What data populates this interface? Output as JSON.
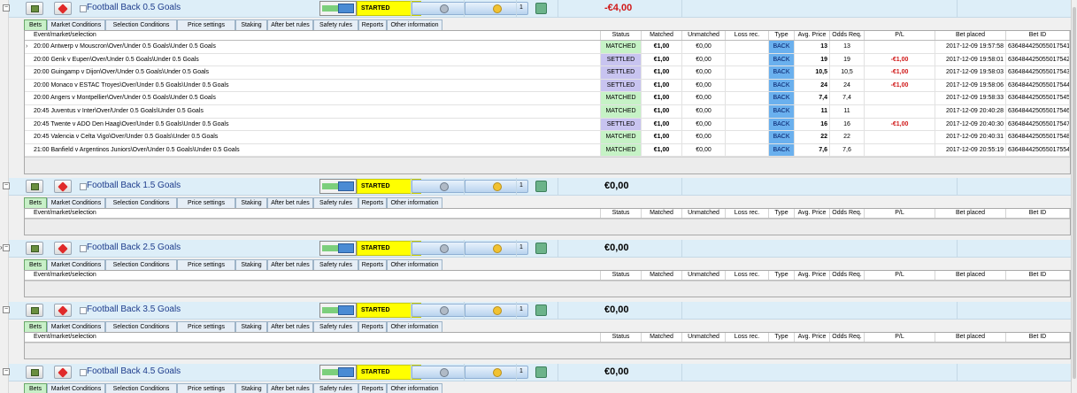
{
  "tab_labels": [
    "Bets",
    "Market Conditions",
    "Selection Conditions",
    "Price settings",
    "Staking",
    "After bet rules",
    "Safety rules",
    "Reports",
    "Other information"
  ],
  "columns": {
    "event": "Event/market/selection",
    "status": "Status",
    "matched": "Matched",
    "unmatched": "Unmatched",
    "loss_rec": "Loss rec.",
    "type": "Type",
    "avg_price": "Avg. Price",
    "odds_req": "Odds Req.",
    "pl": "P/L",
    "bet_placed": "Bet placed",
    "bet_id": "Bet ID"
  },
  "strategies": [
    {
      "name": "Football Back 0.5 Goals",
      "state": "STARTED",
      "count": "1",
      "profit_loss": "-€4,00",
      "bets": [
        {
          "event": "20:00 Antwerp v Mouscron\\Over/Under 0.5 Goals\\Under 0.5 Goals",
          "status": "MATCHED",
          "matched": "€1,00",
          "unmatched": "€0,00",
          "loss_rec": "",
          "type": "BACK",
          "avg_price": "13",
          "odds_req": "13",
          "pl": "",
          "bet_placed": "2017-12-09 19:57:58",
          "bet_id": "636484425055017541"
        },
        {
          "event": "20:00 Genk v Eupen\\Over/Under 0.5 Goals\\Under 0.5 Goals",
          "status": "SETTLED",
          "matched": "€1,00",
          "unmatched": "€0,00",
          "loss_rec": "",
          "type": "BACK",
          "avg_price": "19",
          "odds_req": "19",
          "pl": "-€1,00",
          "bet_placed": "2017-12-09 19:58:01",
          "bet_id": "636484425055017542"
        },
        {
          "event": "20:00 Guingamp v Dijon\\Over/Under 0.5 Goals\\Under 0.5 Goals",
          "status": "SETTLED",
          "matched": "€1,00",
          "unmatched": "€0,00",
          "loss_rec": "",
          "type": "BACK",
          "avg_price": "10,5",
          "odds_req": "10,5",
          "pl": "-€1,00",
          "bet_placed": "2017-12-09 19:58:03",
          "bet_id": "636484425055017543"
        },
        {
          "event": "20:00 Monaco v ESTAC Troyes\\Over/Under 0.5 Goals\\Under 0.5 Goals",
          "status": "SETTLED",
          "matched": "€1,00",
          "unmatched": "€0,00",
          "loss_rec": "",
          "type": "BACK",
          "avg_price": "24",
          "odds_req": "24",
          "pl": "-€1,00",
          "bet_placed": "2017-12-09 19:58:06",
          "bet_id": "636484425055017544"
        },
        {
          "event": "20:00 Angers v Montpellier\\Over/Under 0.5 Goals\\Under 0.5 Goals",
          "status": "MATCHED",
          "matched": "€1,00",
          "unmatched": "€0,00",
          "loss_rec": "",
          "type": "BACK",
          "avg_price": "7,4",
          "odds_req": "7,4",
          "pl": "",
          "bet_placed": "2017-12-09 19:58:33",
          "bet_id": "636484425055017545"
        },
        {
          "event": "20:45 Juventus v Inter\\Over/Under 0.5 Goals\\Under 0.5 Goals",
          "status": "MATCHED",
          "matched": "€1,00",
          "unmatched": "€0,00",
          "loss_rec": "",
          "type": "BACK",
          "avg_price": "11",
          "odds_req": "11",
          "pl": "",
          "bet_placed": "2017-12-09 20:40:28",
          "bet_id": "636484425055017546"
        },
        {
          "event": "20:45 Twente v ADO Den Haag\\Over/Under 0.5 Goals\\Under 0.5 Goals",
          "status": "SETTLED",
          "matched": "€1,00",
          "unmatched": "€0,00",
          "loss_rec": "",
          "type": "BACK",
          "avg_price": "16",
          "odds_req": "16",
          "pl": "-€1,00",
          "bet_placed": "2017-12-09 20:40:30",
          "bet_id": "636484425055017547"
        },
        {
          "event": "20:45 Valencia v Celta Vigo\\Over/Under 0.5 Goals\\Under 0.5 Goals",
          "status": "MATCHED",
          "matched": "€1,00",
          "unmatched": "€0,00",
          "loss_rec": "",
          "type": "BACK",
          "avg_price": "22",
          "odds_req": "22",
          "pl": "",
          "bet_placed": "2017-12-09 20:40:31",
          "bet_id": "636484425055017548"
        },
        {
          "event": "21:00 Banfield v Argentinos Juniors\\Over/Under 0.5 Goals\\Under 0.5 Goals",
          "status": "MATCHED",
          "matched": "€1,00",
          "unmatched": "€0,00",
          "loss_rec": "",
          "type": "BACK",
          "avg_price": "7,6",
          "odds_req": "7,6",
          "pl": "",
          "bet_placed": "2017-12-09 20:55:19",
          "bet_id": "636484425055017554"
        }
      ]
    },
    {
      "name": "Football Back 1.5 Goals",
      "state": "STARTED",
      "count": "1",
      "profit_loss": "€0,00",
      "bets": []
    },
    {
      "name": "Football Back 2.5 Goals",
      "state": "STARTED",
      "count": "1",
      "profit_loss": "€0,00",
      "bets": []
    },
    {
      "name": "Football Back 3.5 Goals",
      "state": "STARTED",
      "count": "1",
      "profit_loss": "€0,00",
      "bets": []
    },
    {
      "name": "Football Back 4.5 Goals",
      "state": "STARTED",
      "count": "1",
      "profit_loss": "€0,00",
      "bets": []
    }
  ],
  "icons": {
    "add": "add-bet-icon",
    "delete": "delete-icon",
    "checkbox": "checkbox-icon",
    "settings": "settings-icon",
    "run": "run-icon",
    "refresh": "refresh-icon"
  },
  "colors": {
    "header_bg": "#ddeef8",
    "started": "#ffff00",
    "matched": "#c6f2c6",
    "settled": "#c8c4f0",
    "back": "#6ab0ee",
    "negative": "#d01818",
    "strategy_name": "#1e3c8c"
  }
}
